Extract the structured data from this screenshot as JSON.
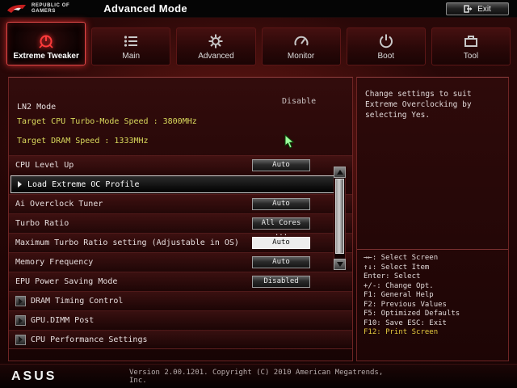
{
  "colors": {
    "accent_red": "#c41e1e",
    "info_yellow": "#d9d95c",
    "hotkey_yellow": "#e3c93e"
  },
  "header": {
    "brand_line1": "REPUBLIC OF",
    "brand_line2": "GAMERS",
    "title": "Advanced Mode",
    "exit_label": "Exit"
  },
  "tabs": [
    {
      "label": "Extreme Tweaker",
      "active": true
    },
    {
      "label": "Main",
      "active": false
    },
    {
      "label": "Advanced",
      "active": false
    },
    {
      "label": "Monitor",
      "active": false
    },
    {
      "label": "Boot",
      "active": false
    },
    {
      "label": "Tool",
      "active": false
    }
  ],
  "main": {
    "ln2": {
      "label": "LN2 Mode",
      "value": "Disable"
    },
    "info_lines": [
      "Target CPU Turbo-Mode Speed : 3800MHz",
      "Target DRAM Speed : 1333MHz"
    ],
    "rows": [
      {
        "label": "CPU Level Up",
        "value": "Auto"
      },
      {
        "label": "Load Extreme OC Profile"
      },
      {
        "label": "Ai Overclock Tuner",
        "value": "Auto"
      },
      {
        "label": "Turbo Ratio",
        "value": "All Cores ..."
      },
      {
        "label": "Maximum Turbo Ratio setting (Adjustable in OS)",
        "value": "Auto",
        "selected": true
      },
      {
        "label": "Memory Frequency",
        "value": "Auto"
      },
      {
        "label": "EPU Power Saving Mode",
        "value": "Disabled"
      },
      {
        "label": "DRAM Timing Control"
      },
      {
        "label": "GPU.DIMM Post"
      },
      {
        "label": "CPU Performance Settings"
      }
    ]
  },
  "help": {
    "text": "Change settings to suit Extreme Overclocking by selecting Yes.",
    "keys": [
      "→←: Select Screen",
      "↑↓: Select Item",
      "Enter: Select",
      "+/-: Change Opt.",
      "F1: General Help",
      "F2: Previous Values",
      "F5: Optimized Defaults",
      "F10: Save ESC: Exit",
      "F12: Print Screen"
    ]
  },
  "footer": {
    "brand": "ASUS",
    "version": "Version 2.00.1201. Copyright (C) 2010 American Megatrends, Inc."
  }
}
